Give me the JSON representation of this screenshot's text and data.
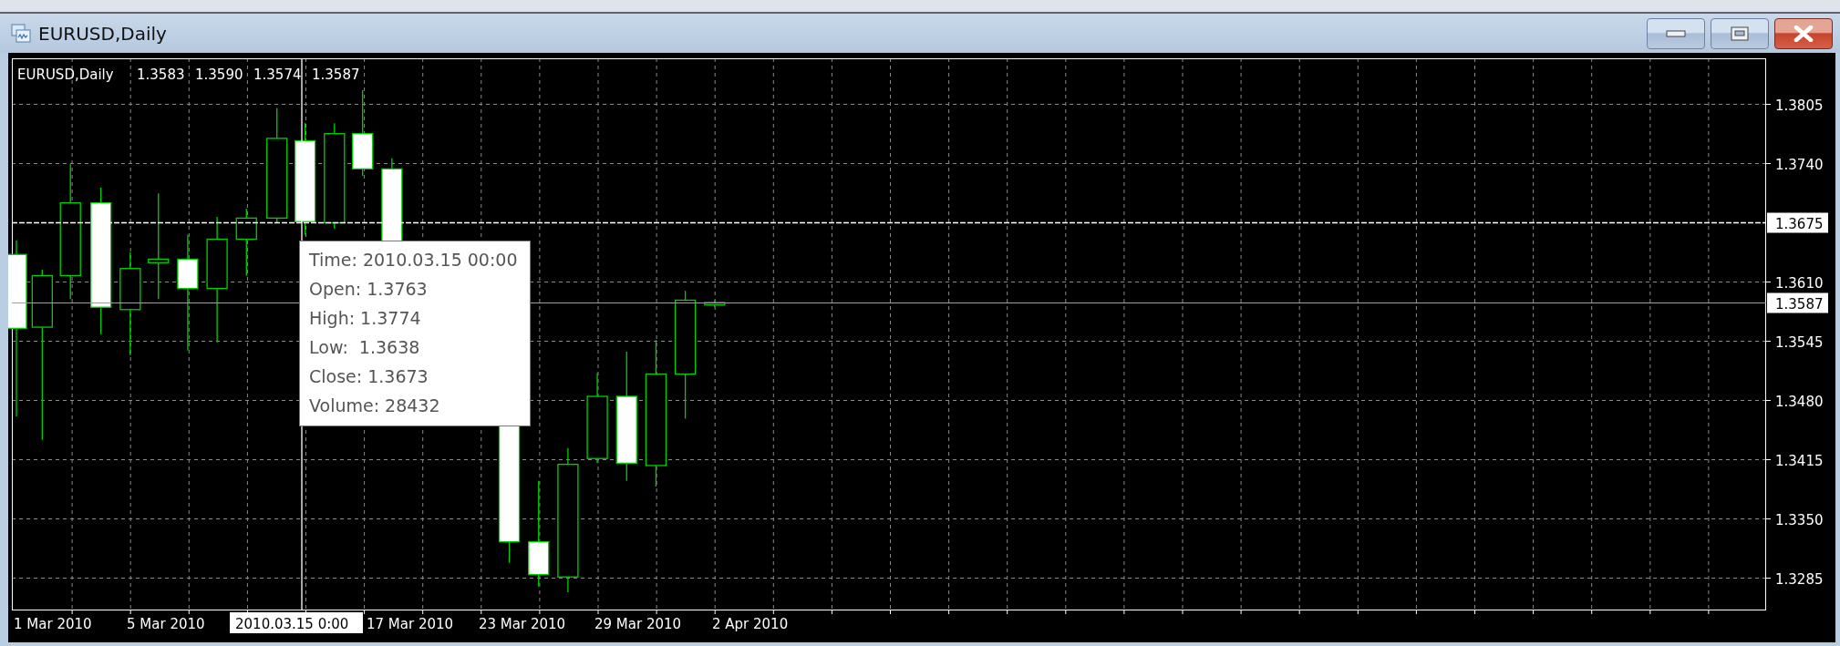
{
  "window": {
    "title": "EURUSD,Daily"
  },
  "chart": {
    "header": {
      "symbol": "EURUSD,Daily",
      "prices": [
        "1.3583",
        "1.3590",
        "1.3574",
        "1.3587"
      ]
    },
    "price_axis": [
      "1.3805",
      "1.3740",
      "1.3610",
      "1.3545",
      "1.3480",
      "1.3415",
      "1.3350",
      "1.3285"
    ],
    "crosshair_price": "1.3675",
    "bid_price": "1.3587",
    "date_axis": [
      "1 Mar 2010",
      "5 Mar 2010",
      "17 Mar 2010",
      "23 Mar 2010",
      "29 Mar 2010",
      "2 Apr 2010"
    ],
    "crosshair_time": "2010.03.15 0:00",
    "tooltip": [
      "Time: 2010.03.15 00:00",
      "Open: 1.3763",
      "High: 1.3774",
      "Low:  1.3638",
      "Close: 1.3673",
      "Volume: 28432"
    ]
  }
}
